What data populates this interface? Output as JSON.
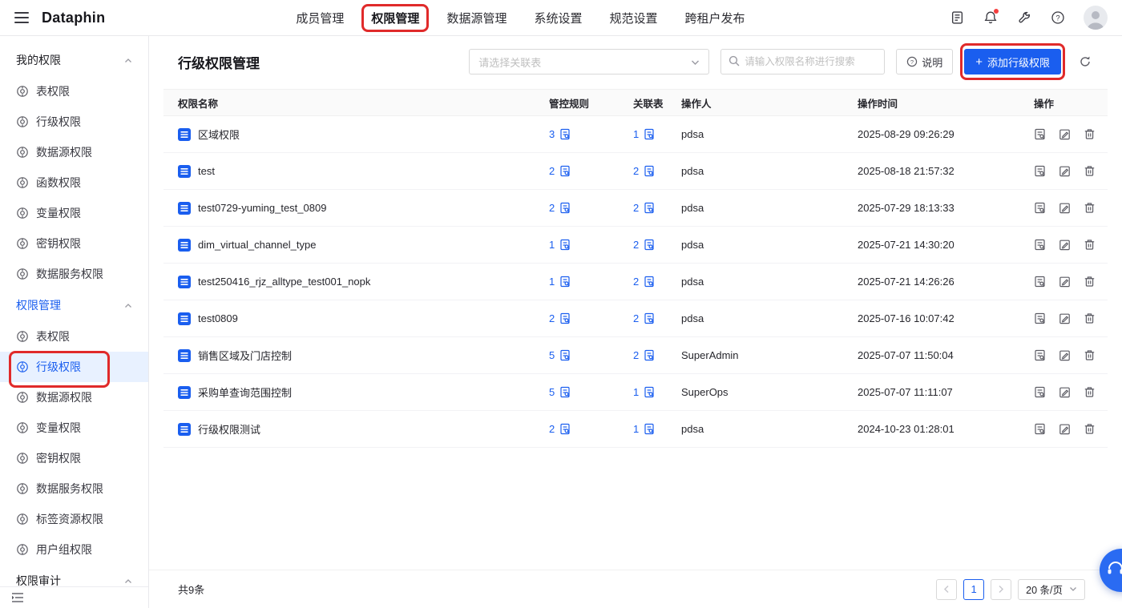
{
  "topbar": {
    "logo": "Dataphin",
    "nav": [
      {
        "label": "成员管理",
        "active": false,
        "annotated": false
      },
      {
        "label": "权限管理",
        "active": true,
        "annotated": true
      },
      {
        "label": "数据源管理",
        "active": false,
        "annotated": false
      },
      {
        "label": "系统设置",
        "active": false,
        "annotated": false
      },
      {
        "label": "规范设置",
        "active": false,
        "annotated": false
      },
      {
        "label": "跨租户发布",
        "active": false,
        "annotated": false
      }
    ]
  },
  "sidebar": {
    "groups": [
      {
        "title": "我的权限",
        "active": false,
        "items": [
          {
            "label": "表权限",
            "active": false,
            "annotated": false
          },
          {
            "label": "行级权限",
            "active": false,
            "annotated": false
          },
          {
            "label": "数据源权限",
            "active": false,
            "annotated": false
          },
          {
            "label": "函数权限",
            "active": false,
            "annotated": false
          },
          {
            "label": "变量权限",
            "active": false,
            "annotated": false
          },
          {
            "label": "密钥权限",
            "active": false,
            "annotated": false
          },
          {
            "label": "数据服务权限",
            "active": false,
            "annotated": false
          }
        ]
      },
      {
        "title": "权限管理",
        "active": true,
        "items": [
          {
            "label": "表权限",
            "active": false,
            "annotated": false
          },
          {
            "label": "行级权限",
            "active": true,
            "annotated": true
          },
          {
            "label": "数据源权限",
            "active": false,
            "annotated": false
          },
          {
            "label": "变量权限",
            "active": false,
            "annotated": false
          },
          {
            "label": "密钥权限",
            "active": false,
            "annotated": false
          },
          {
            "label": "数据服务权限",
            "active": false,
            "annotated": false
          },
          {
            "label": "标签资源权限",
            "active": false,
            "annotated": false
          },
          {
            "label": "用户组权限",
            "active": false,
            "annotated": false
          }
        ]
      },
      {
        "title": "权限审计",
        "active": false,
        "items": []
      }
    ]
  },
  "main": {
    "title": "行级权限管理",
    "toolbar": {
      "select_placeholder": "请选择关联表",
      "search_placeholder": "请输入权限名称进行搜索",
      "help_label": "说明",
      "add_icon": "+",
      "add_label": "添加行级权限"
    },
    "table": {
      "columns": [
        "权限名称",
        "管控规则",
        "关联表",
        "操作人",
        "操作时间",
        "操作"
      ],
      "rows": [
        {
          "name": "区域权限",
          "rules": "3",
          "tables": "1",
          "operator": "pdsa",
          "time": "2025-08-29 09:26:29"
        },
        {
          "name": "test",
          "rules": "2",
          "tables": "2",
          "operator": "pdsa",
          "time": "2025-08-18 21:57:32"
        },
        {
          "name": "test0729-yuming_test_0809",
          "rules": "2",
          "tables": "2",
          "operator": "pdsa",
          "time": "2025-07-29 18:13:33"
        },
        {
          "name": "dim_virtual_channel_type",
          "rules": "1",
          "tables": "2",
          "operator": "pdsa",
          "time": "2025-07-21 14:30:20"
        },
        {
          "name": "test250416_rjz_alltype_test001_nopk",
          "rules": "1",
          "tables": "2",
          "operator": "pdsa",
          "time": "2025-07-21 14:26:26"
        },
        {
          "name": "test0809",
          "rules": "2",
          "tables": "2",
          "operator": "pdsa",
          "time": "2025-07-16 10:07:42"
        },
        {
          "name": "销售区域及门店控制",
          "rules": "5",
          "tables": "2",
          "operator": "SuperAdmin",
          "time": "2025-07-07 11:50:04"
        },
        {
          "name": "采购单查询范围控制",
          "rules": "5",
          "tables": "1",
          "operator": "SuperOps",
          "time": "2025-07-07 11:11:07"
        },
        {
          "name": "行级权限测试",
          "rules": "2",
          "tables": "1",
          "operator": "pdsa",
          "time": "2024-10-23 01:28:01"
        }
      ]
    },
    "footer": {
      "total": "共9条",
      "page": "1",
      "page_size": "20 条/页"
    }
  },
  "colors": {
    "primary": "#1a5eef",
    "annotation": "#e02a2a",
    "active_item_bg": "#e8f1ff"
  }
}
